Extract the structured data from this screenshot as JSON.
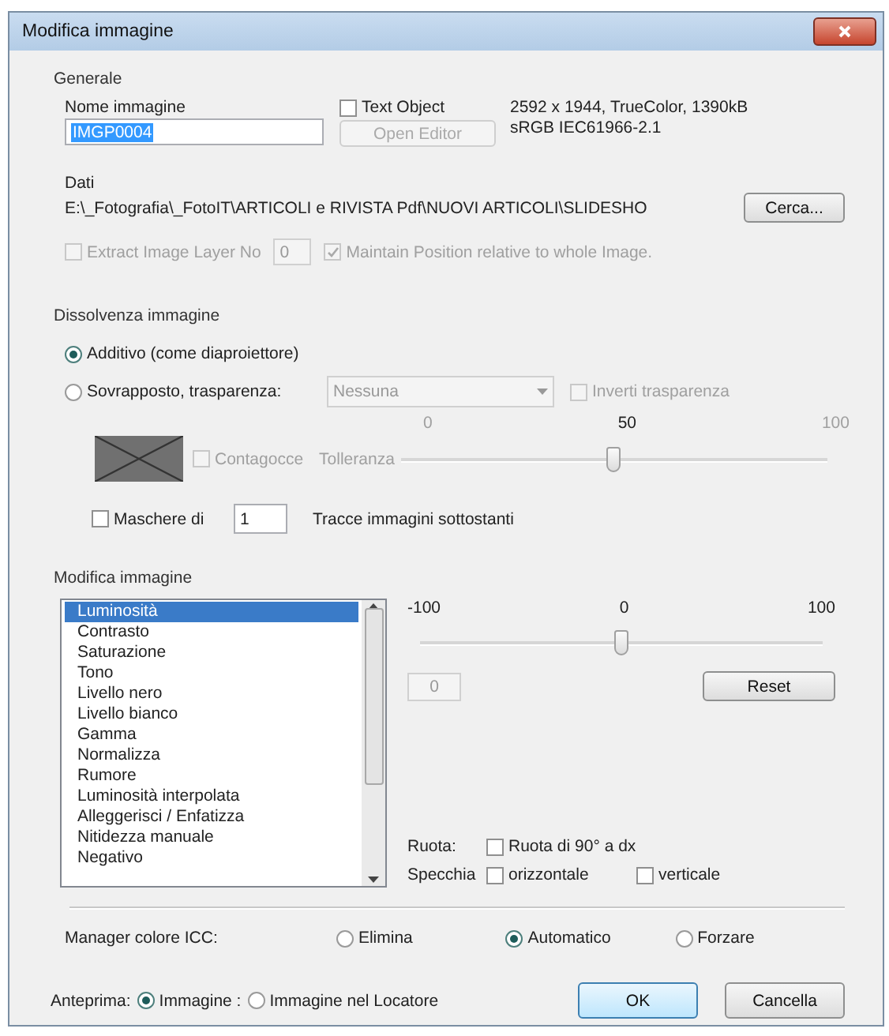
{
  "window": {
    "title": "Modifica immagine"
  },
  "generale": {
    "heading": "Generale",
    "name_label": "Nome immagine",
    "name_value": "IMGP0004",
    "text_object": {
      "label": "Text Object",
      "checked": false
    },
    "open_editor": {
      "label": "Open Editor",
      "disabled": true
    },
    "info": [
      "2592 x 1944, TrueColor, 1390kB",
      "sRGB IEC61966-2.1"
    ],
    "path_label": "Dati",
    "path": "E:\\_Fotografia\\_FotoIT\\ARTICOLI e RIVISTA Pdf\\NUOVI ARTICOLI\\SLIDESHO",
    "browse": "Cerca...",
    "extract": {
      "label": "Extract Image Layer No",
      "checked": false,
      "disabled": true
    },
    "layer_value": "0",
    "maintain": {
      "label": "Maintain Position relative to whole Image.",
      "checked": true,
      "disabled": true
    }
  },
  "dissolvenza": {
    "heading": "Dissolvenza immagine",
    "modes": [
      {
        "label": "Additivo (come diaproiettore)",
        "selected": true
      },
      {
        "label": "Sovrapposto, trasparenza:",
        "selected": false
      }
    ],
    "transparency": "Nessuna",
    "invert": {
      "label": "Inverti trasparenza",
      "checked": false,
      "disabled": true
    },
    "ticks": [
      "0",
      "50",
      "100"
    ],
    "dropper": {
      "label": "Contagocce",
      "checked": false,
      "disabled": true
    },
    "tolerance_label": "Tolleranza",
    "tolerance": {
      "level": 0.5
    },
    "masks": {
      "label": "Maschere di",
      "checked": false
    },
    "masks_value": "1",
    "masks_suffix": "Tracce immagini sottostanti"
  },
  "modifica": {
    "heading": "Modifica immagine",
    "items": [
      {
        "label": "Luminosità",
        "selected": true
      },
      {
        "label": "Contrasto",
        "selected": false
      },
      {
        "label": "Saturazione",
        "selected": false
      },
      {
        "label": "Tono",
        "selected": false
      },
      {
        "label": "Livello nero",
        "selected": false
      },
      {
        "label": "Livello bianco",
        "selected": false
      },
      {
        "label": "Gamma",
        "selected": false
      },
      {
        "label": "Normalizza",
        "selected": false
      },
      {
        "label": "Rumore",
        "selected": false
      },
      {
        "label": "Luminosità interpolata",
        "selected": false
      },
      {
        "label": "Alleggerisci / Enfatizza",
        "selected": false
      },
      {
        "label": "Nitidezza manuale",
        "selected": false
      },
      {
        "label": "Negativo",
        "selected": false
      }
    ],
    "ticks": [
      "-100",
      "0",
      "100"
    ],
    "adjust": {
      "level": 0.5
    },
    "value": "0",
    "reset": "Reset",
    "rotate_label": "Ruota:",
    "rotate": {
      "label": "Ruota di 90° a dx",
      "checked": false
    },
    "mirror_label": "Specchia",
    "mirror": [
      {
        "label": "orizzontale",
        "checked": false
      },
      {
        "label": "verticale",
        "checked": false
      }
    ]
  },
  "icc": {
    "label": "Manager colore ICC:",
    "options": [
      {
        "label": "Elimina",
        "selected": false
      },
      {
        "label": "Automatico",
        "selected": true
      },
      {
        "label": "Forzare",
        "selected": false
      }
    ]
  },
  "preview": {
    "label": "Anteprima:",
    "options": [
      {
        "label": "Immagine :",
        "selected": true
      },
      {
        "label": "Immagine nel Locatore",
        "selected": false
      }
    ]
  },
  "buttons": [
    {
      "label": "OK",
      "default": true
    },
    {
      "label": "Cancella",
      "default": false
    }
  ]
}
